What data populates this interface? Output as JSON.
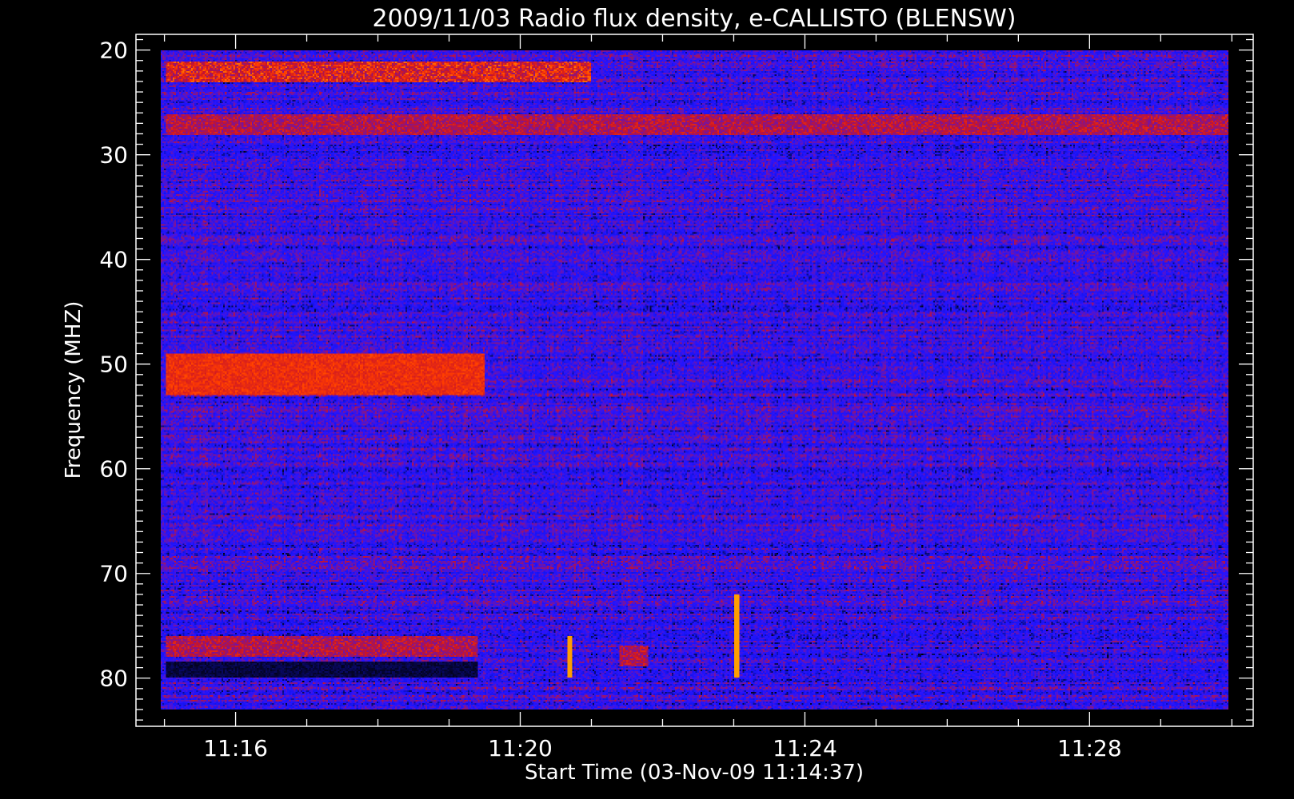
{
  "chart_data": {
    "type": "heatmap",
    "title": "2009/11/03  Radio flux density, e-CALLISTO (BLENSW)",
    "xlabel": "Start Time (03-Nov-09 11:14:37)",
    "ylabel": "Frequency (MHZ)",
    "x_ticks": [
      "11:16",
      "11:20",
      "11:24",
      "11:28"
    ],
    "y_ticks": [
      20,
      30,
      40,
      50,
      60,
      70,
      80
    ],
    "x_range_minutes": [
      14.6,
      30.3
    ],
    "data_time_range_minutes": [
      14.95,
      29.95
    ],
    "y_range_mhz": [
      18.5,
      84.6
    ],
    "data_freq_range_mhz": [
      20,
      83
    ],
    "y_inverted": true,
    "colormap": [
      "#000000",
      "#0000ff",
      "#ff0000",
      "#ffd200"
    ],
    "features": [
      {
        "freq_mhz": [
          21,
          23
        ],
        "time_minutes": [
          15,
          21
        ],
        "level": "orange"
      },
      {
        "freq_mhz": [
          26,
          28
        ],
        "time_minutes": [
          15,
          30
        ],
        "level": "red-orange"
      },
      {
        "freq_mhz": [
          49,
          53
        ],
        "time_minutes": [
          15,
          19.5
        ],
        "level": "bright red"
      },
      {
        "freq_mhz": [
          76,
          78
        ],
        "time_minutes": [
          15,
          19.4
        ],
        "level": "red"
      },
      {
        "freq_mhz": [
          78.5,
          80
        ],
        "time_minutes": [
          15,
          19.4
        ],
        "level": "black"
      },
      {
        "freq_mhz": [
          77,
          79
        ],
        "time_minutes": [
          21.4,
          21.8
        ],
        "level": "red"
      },
      {
        "freq_mhz": [
          76,
          80
        ],
        "time_minutes": [
          20.7,
          20.7
        ],
        "level": "spike"
      },
      {
        "freq_mhz": [
          72,
          80
        ],
        "time_minutes": [
          23.05,
          23.05
        ],
        "level": "spike"
      }
    ]
  }
}
